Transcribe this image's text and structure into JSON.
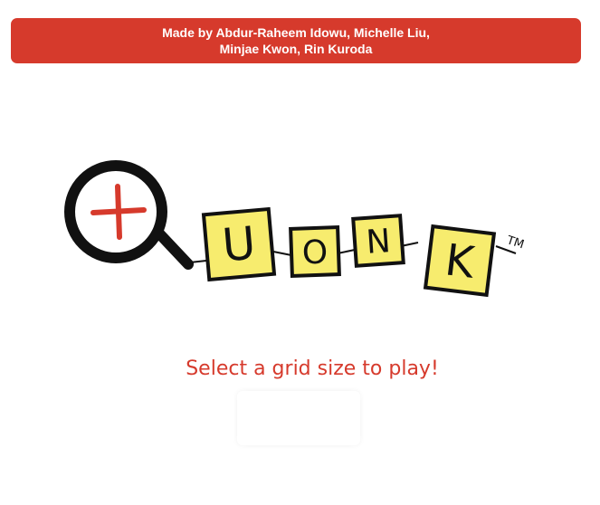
{
  "header": {
    "credits_line1": "Made by Abdur-Raheem Idowu, Michelle Liu,",
    "credits_line2": "Minjae Kwon, Rin Kuroda"
  },
  "logo": {
    "letters": [
      "U",
      "O",
      "N",
      "K"
    ],
    "trademark": "TM"
  },
  "main": {
    "prompt": "Select a grid size to play!"
  },
  "colors": {
    "accent_red": "#d63a2c",
    "tile_yellow": "#f7ec6e",
    "ink": "#111111"
  }
}
